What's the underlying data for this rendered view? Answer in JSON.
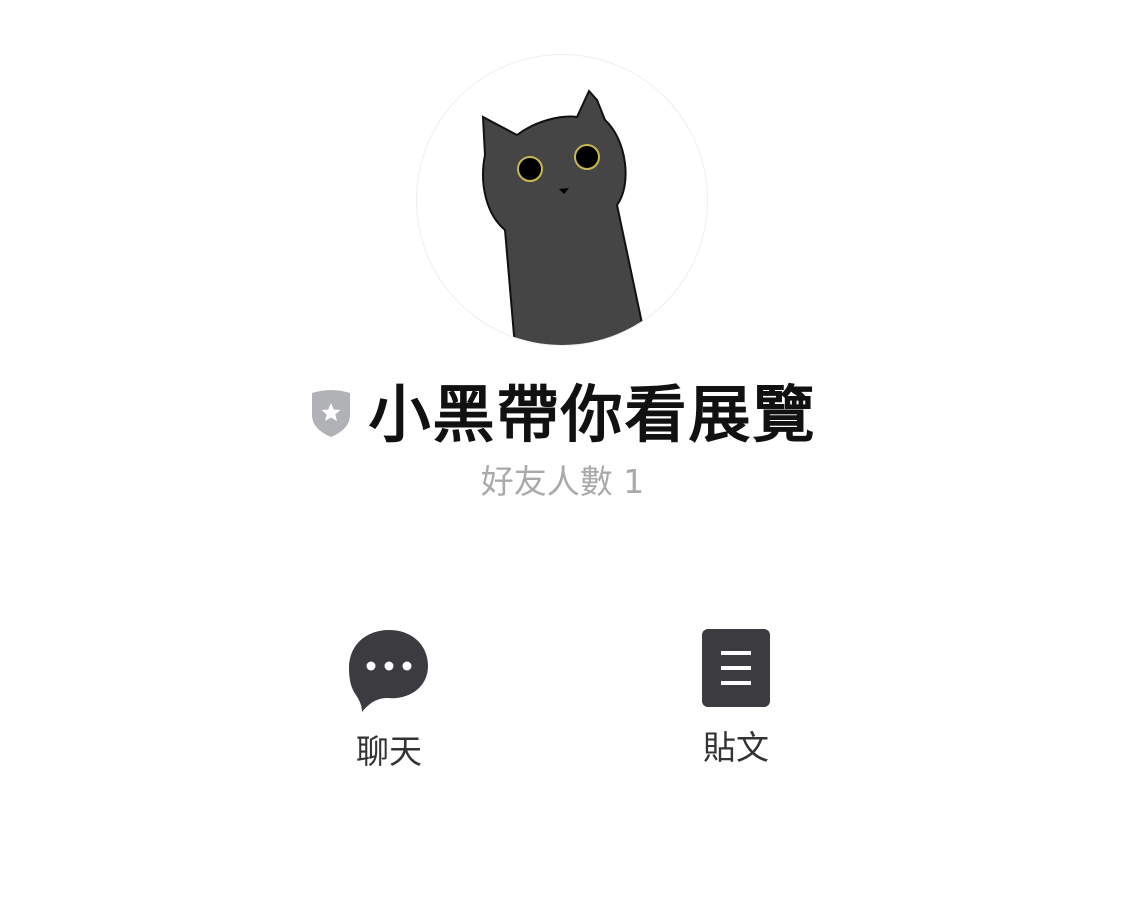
{
  "profile": {
    "name": "小黑帶你看展覽",
    "friends_label": "好友人數",
    "friends_count": "1",
    "friends_text": "好友人數 1",
    "badge_icon": "shield-star-icon",
    "avatar": "black-cat-illustration"
  },
  "actions": [
    {
      "label": "聊天",
      "icon": "chat-bubble-icon"
    },
    {
      "label": "貼文",
      "icon": "posts-list-icon"
    }
  ],
  "colors": {
    "icon": "#3c3c40",
    "badge": "#b0b2b6",
    "friends_text": "#aaaaaa",
    "cat": "#454545"
  }
}
